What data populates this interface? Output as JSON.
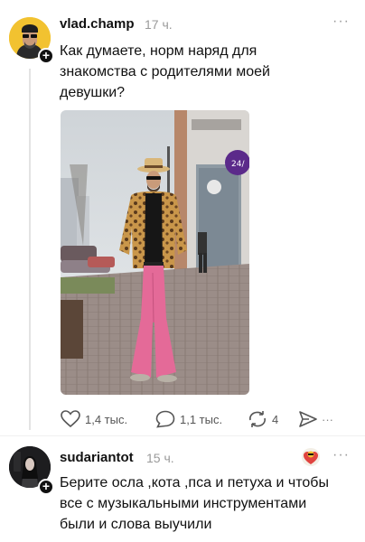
{
  "post": {
    "username": "vlad.champ",
    "time": "17 ч.",
    "text_lines": [
      "Как думаете, норм наряд для",
      "знакомства с родителями моей",
      "девушки?"
    ],
    "photo": {
      "store_sign": "24/"
    },
    "actions": {
      "likes": "1,4 тыс.",
      "comments": "1,1 тыс.",
      "reposts": "4"
    },
    "more_label": "···"
  },
  "reply": {
    "username": "sudariantot",
    "time": "15 ч.",
    "text_lines": [
      "Берите осла ,кота ,пса и петуха и чтобы",
      "все с музыкальными инструментами",
      "были и слова выучили"
    ],
    "more_label": "···"
  },
  "colors": {
    "avatar_main_bg": "#f2c230",
    "pants_pink": "#e46a98",
    "leopard": "#c9964a",
    "store_sign": "#5b2a8a"
  },
  "icons": [
    "plus-icon",
    "heart-icon",
    "comment-icon",
    "repost-icon",
    "share-icon",
    "more-icon"
  ]
}
